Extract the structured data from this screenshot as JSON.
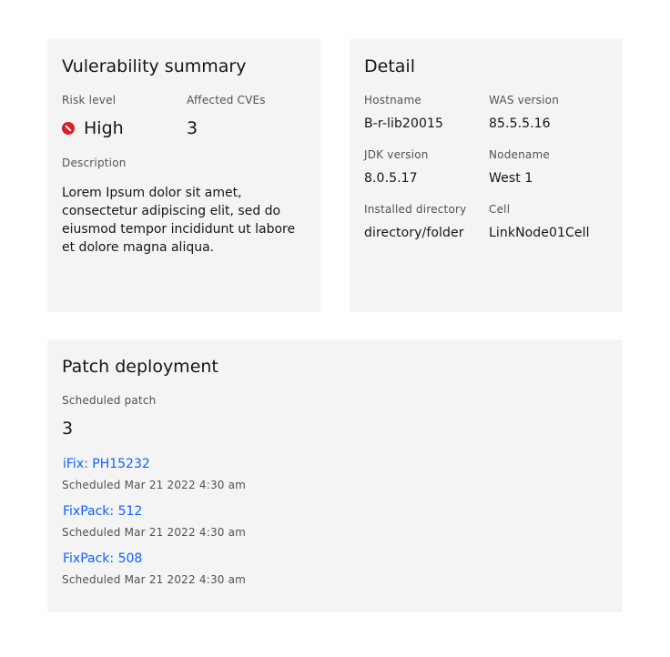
{
  "vulnerability": {
    "title": "Vulerability summary",
    "risk_label": "Risk level",
    "risk_value": "High",
    "risk_icon": "blocked-icon",
    "risk_color": "#da1e28",
    "cves_label": "Affected CVEs",
    "cves_value": "3",
    "description_label": "Description",
    "description": "Lorem Ipsum dolor sit amet, consectetur adipiscing elit, sed do eiusmod tempor incididunt ut labore et dolore magna aliqua."
  },
  "detail": {
    "title": "Detail",
    "hostname_label": "Hostname",
    "hostname": "B-r-lib20015",
    "was_label": "WAS version",
    "was": "85.5.5.16",
    "jdk_label": "JDK version",
    "jdk": "8.0.5.17",
    "nodename_label": "Nodename",
    "nodename": "West 1",
    "dir_label": "Installed directory",
    "dir": "directory/folder",
    "cell_label": "Cell",
    "cell": "LinkNode01Cell"
  },
  "patch": {
    "title": "Patch deployment",
    "scheduled_label": "Scheduled patch",
    "scheduled_count": "3",
    "items": [
      {
        "name": "iFix: PH15232",
        "schedule": "Scheduled Mar 21 2022 4:30 am"
      },
      {
        "name": "FixPack: 512",
        "schedule": "Scheduled Mar 21 2022 4:30 am"
      },
      {
        "name": "FixPack: 508",
        "schedule": "Scheduled Mar 21 2022 4:30 am"
      }
    ],
    "link_color": "#0f62fe"
  }
}
